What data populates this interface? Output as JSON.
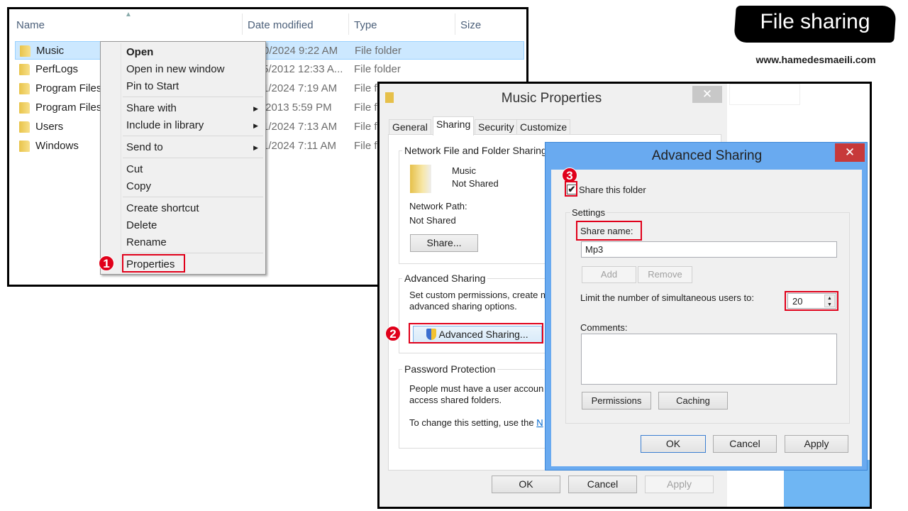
{
  "explorer": {
    "columns": [
      "Name",
      "Date modified",
      "Type",
      "Size"
    ],
    "rows": [
      {
        "name": "Music",
        "date": "0/2024 9:22 AM",
        "type": "File folder"
      },
      {
        "name": "PerfLogs",
        "date": "5/2012 12:33 A...",
        "type": "File folder"
      },
      {
        "name": "Program Files",
        "date": "1/2024 7:19 AM",
        "type": "File f"
      },
      {
        "name": "Program Files",
        "date": "/2013 5:59 PM",
        "type": "File f"
      },
      {
        "name": "Users",
        "date": "1/2024 7:13 AM",
        "type": "File f"
      },
      {
        "name": "Windows",
        "date": "1/2024 7:11 AM",
        "type": "File f"
      }
    ]
  },
  "context_menu": {
    "items": [
      "Open",
      "Open in new window",
      "Pin to Start",
      "Share with",
      "Include in library",
      "Send to",
      "Cut",
      "Copy",
      "Create shortcut",
      "Delete",
      "Rename",
      "Properties"
    ]
  },
  "steps": [
    "1",
    "2",
    "3"
  ],
  "properties": {
    "title": "Music Properties",
    "tabs": [
      "General",
      "Sharing",
      "Security",
      "Customize"
    ],
    "nffs_label": "Network File and Folder Sharing",
    "folder_name": "Music",
    "folder_status": "Not Shared",
    "network_path_label": "Network Path:",
    "network_path": "Not Shared",
    "share_button": "Share...",
    "adv_label": "Advanced Sharing",
    "adv_text1": "Set custom permissions, create m",
    "adv_text2": "advanced sharing options.",
    "adv_button": "Advanced Sharing...",
    "pw_label": "Password Protection",
    "pw_text1": "People must have a user accoun",
    "pw_text2": "access shared folders.",
    "pw_text3": "To change this setting, use the ",
    "pw_link": "N",
    "ok": "OK",
    "cancel": "Cancel",
    "apply": "Apply"
  },
  "advanced": {
    "title": "Advanced Sharing",
    "share_checkbox": "Share this folder",
    "share_checked": true,
    "settings_label": "Settings",
    "share_name_label": "Share name:",
    "share_name": "Mp3",
    "add": "Add",
    "remove": "Remove",
    "limit_label": "Limit the number of simultaneous users to:",
    "limit_value": "20",
    "comments_label": "Comments:",
    "permissions": "Permissions",
    "caching": "Caching",
    "ok": "OK",
    "cancel": "Cancel",
    "apply": "Apply"
  },
  "brand": {
    "title": "File sharing",
    "url": "www.hamedesmaeili.com"
  },
  "colors": {
    "highlight": "#e0001a",
    "selection": "#cce8ff",
    "dialog_frame": "#69aaf0",
    "close_red": "#c7393a"
  }
}
